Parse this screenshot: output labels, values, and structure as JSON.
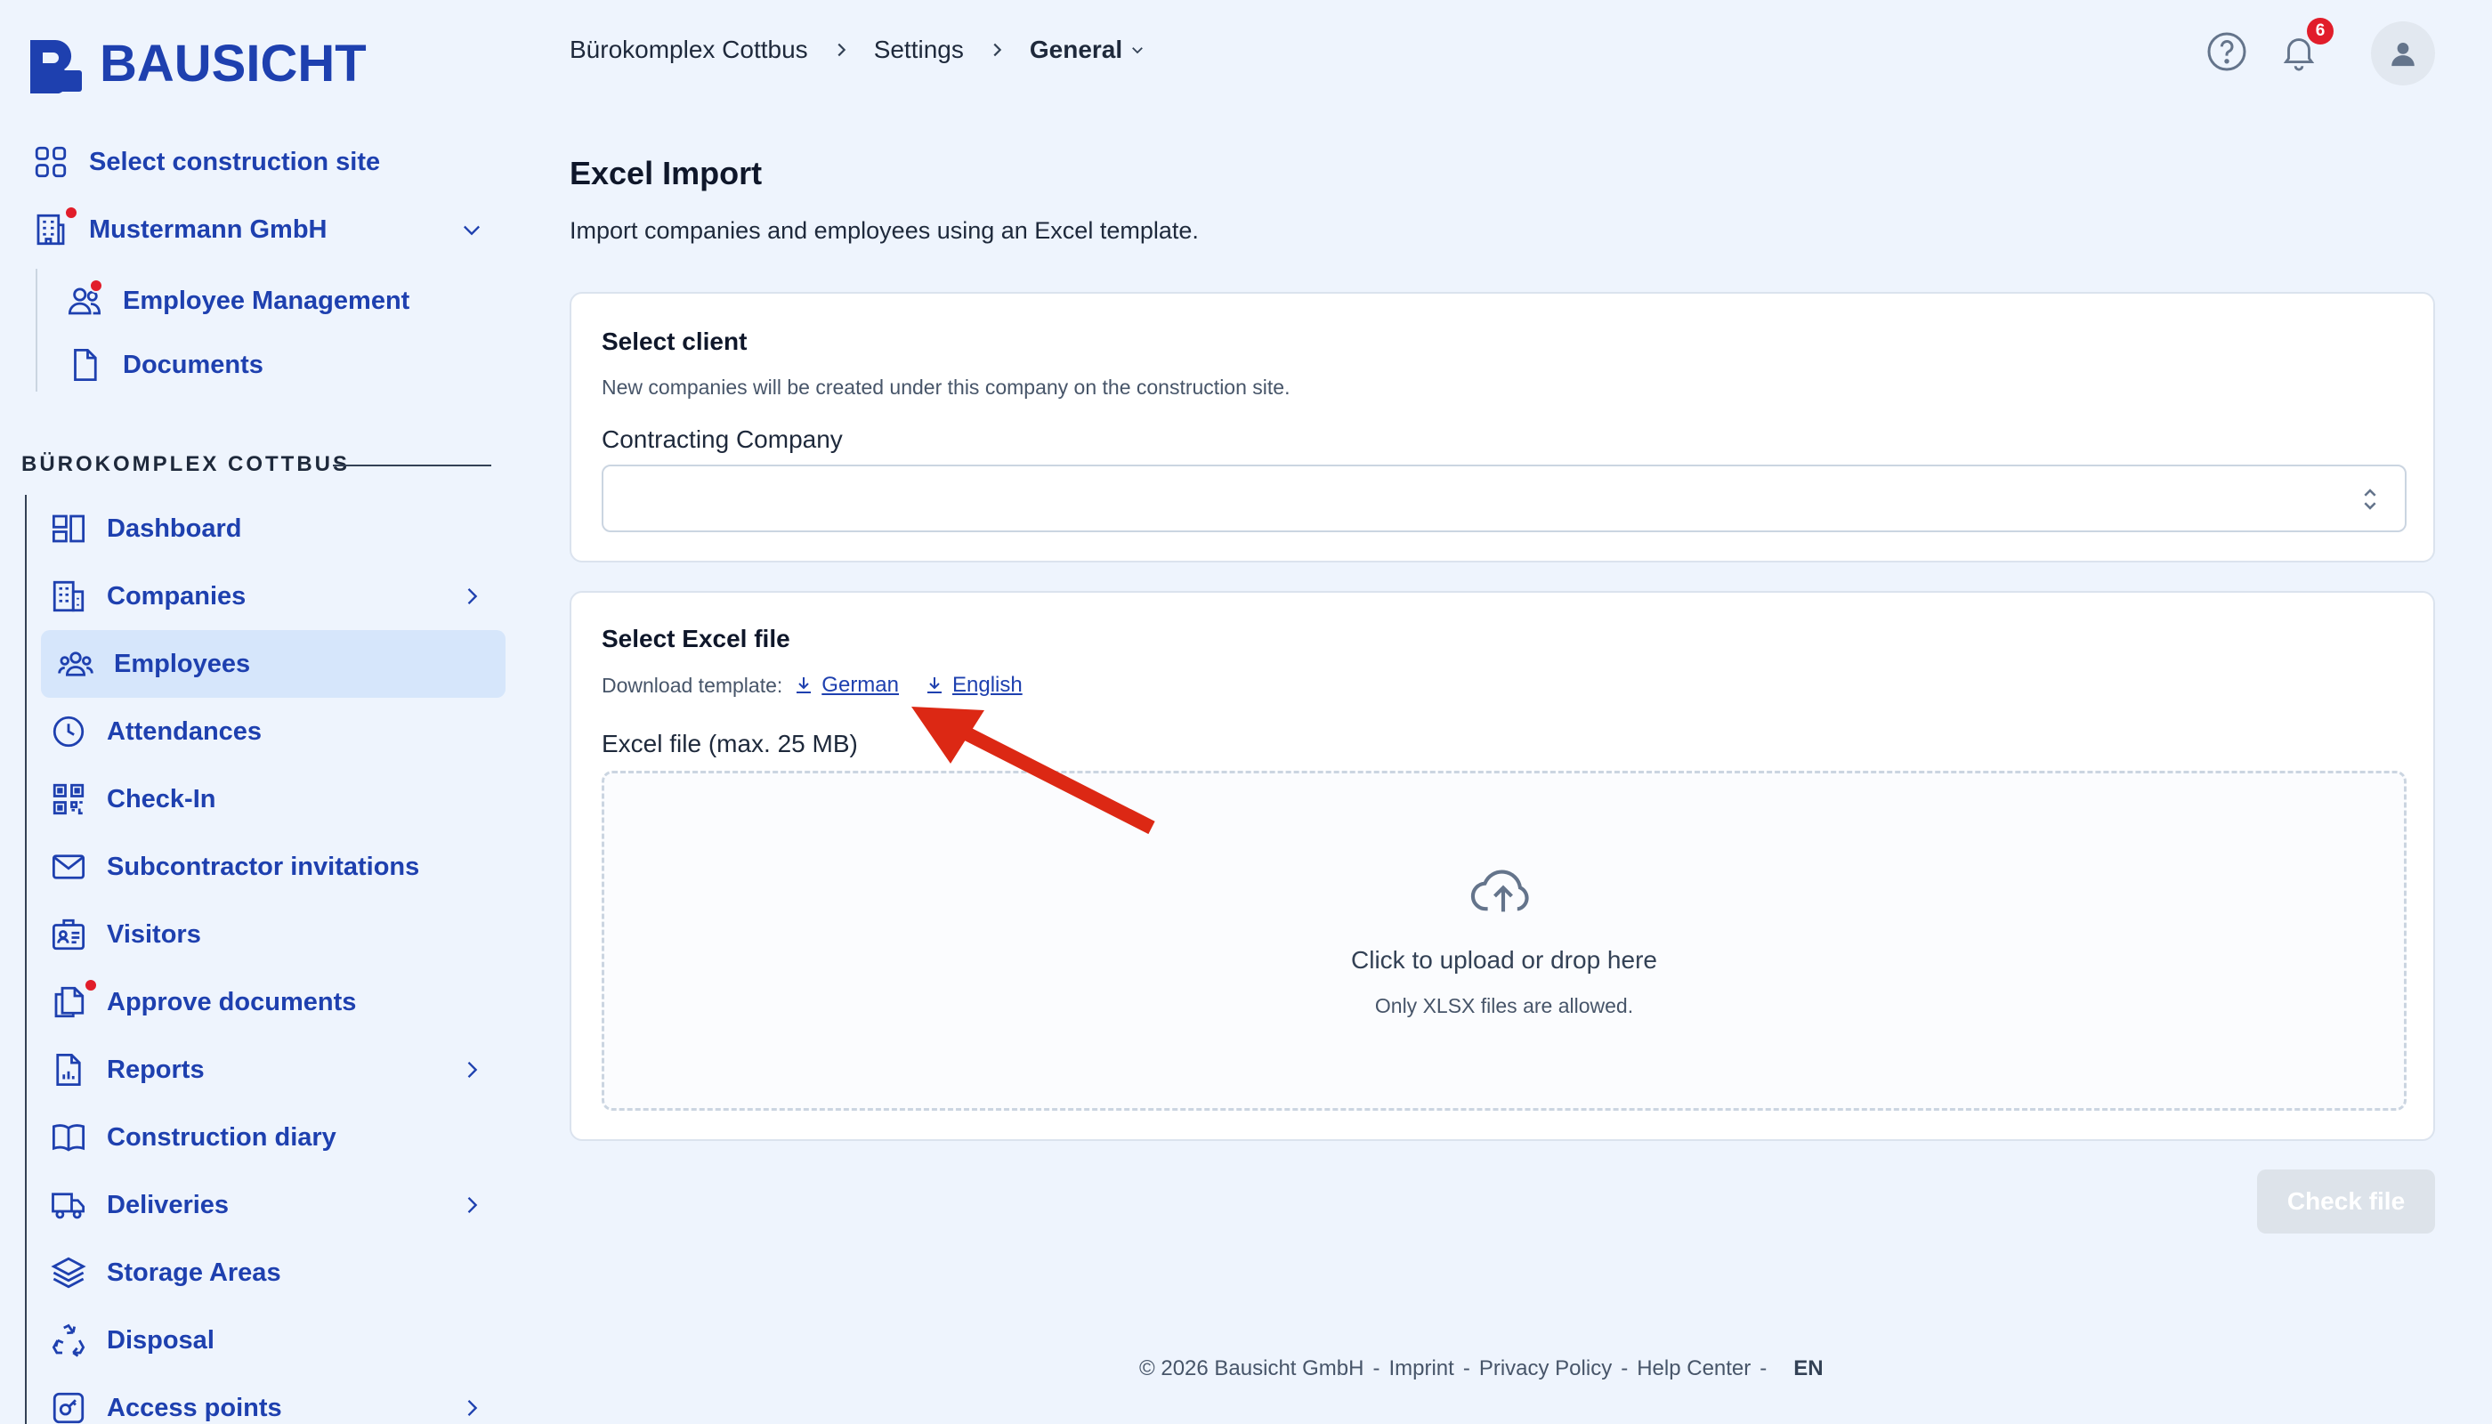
{
  "brand": {
    "name": "BAUSICHT"
  },
  "sidebar": {
    "select_site": "Select construction site",
    "company": "Mustermann GmbH",
    "company_items": [
      {
        "label": "Employee Management"
      },
      {
        "label": "Documents"
      }
    ],
    "section_title": "BÜROKOMPLEX COTTBUS",
    "nav": [
      {
        "label": "Dashboard"
      },
      {
        "label": "Companies"
      },
      {
        "label": "Employees"
      },
      {
        "label": "Attendances"
      },
      {
        "label": "Check-In"
      },
      {
        "label": "Subcontractor invitations"
      },
      {
        "label": "Visitors"
      },
      {
        "label": "Approve documents"
      },
      {
        "label": "Reports"
      },
      {
        "label": "Construction diary"
      },
      {
        "label": "Deliveries"
      },
      {
        "label": "Storage Areas"
      },
      {
        "label": "Disposal"
      },
      {
        "label": "Access points"
      }
    ]
  },
  "breadcrumb": {
    "site": "Bürokomplex Cottbus",
    "section": "Settings",
    "current": "General"
  },
  "header": {
    "notification_count": "6"
  },
  "page": {
    "title": "Excel Import",
    "subtitle": "Import companies and employees using an Excel template."
  },
  "client_card": {
    "title": "Select client",
    "note": "New companies will be created under this company on the construction site.",
    "field_label": "Contracting Company",
    "value": ""
  },
  "file_card": {
    "title": "Select Excel file",
    "download_label": "Download template:",
    "link_german": "German",
    "link_english": "English",
    "field_label": "Excel file (max. 25 MB)",
    "drop_title": "Click to upload or drop here",
    "drop_note": "Only XLSX files are allowed."
  },
  "actions": {
    "check_file": "Check file"
  },
  "footer": {
    "copyright": "© 2026 Bausicht GmbH",
    "imprint": "Imprint",
    "privacy": "Privacy Policy",
    "help": "Help Center",
    "sep": "-",
    "lang": "EN"
  },
  "colors": {
    "brand": "#1e40af",
    "alert": "#e11d2a",
    "active_bg": "#d6e6fb",
    "annotation_arrow": "#dc2814"
  }
}
